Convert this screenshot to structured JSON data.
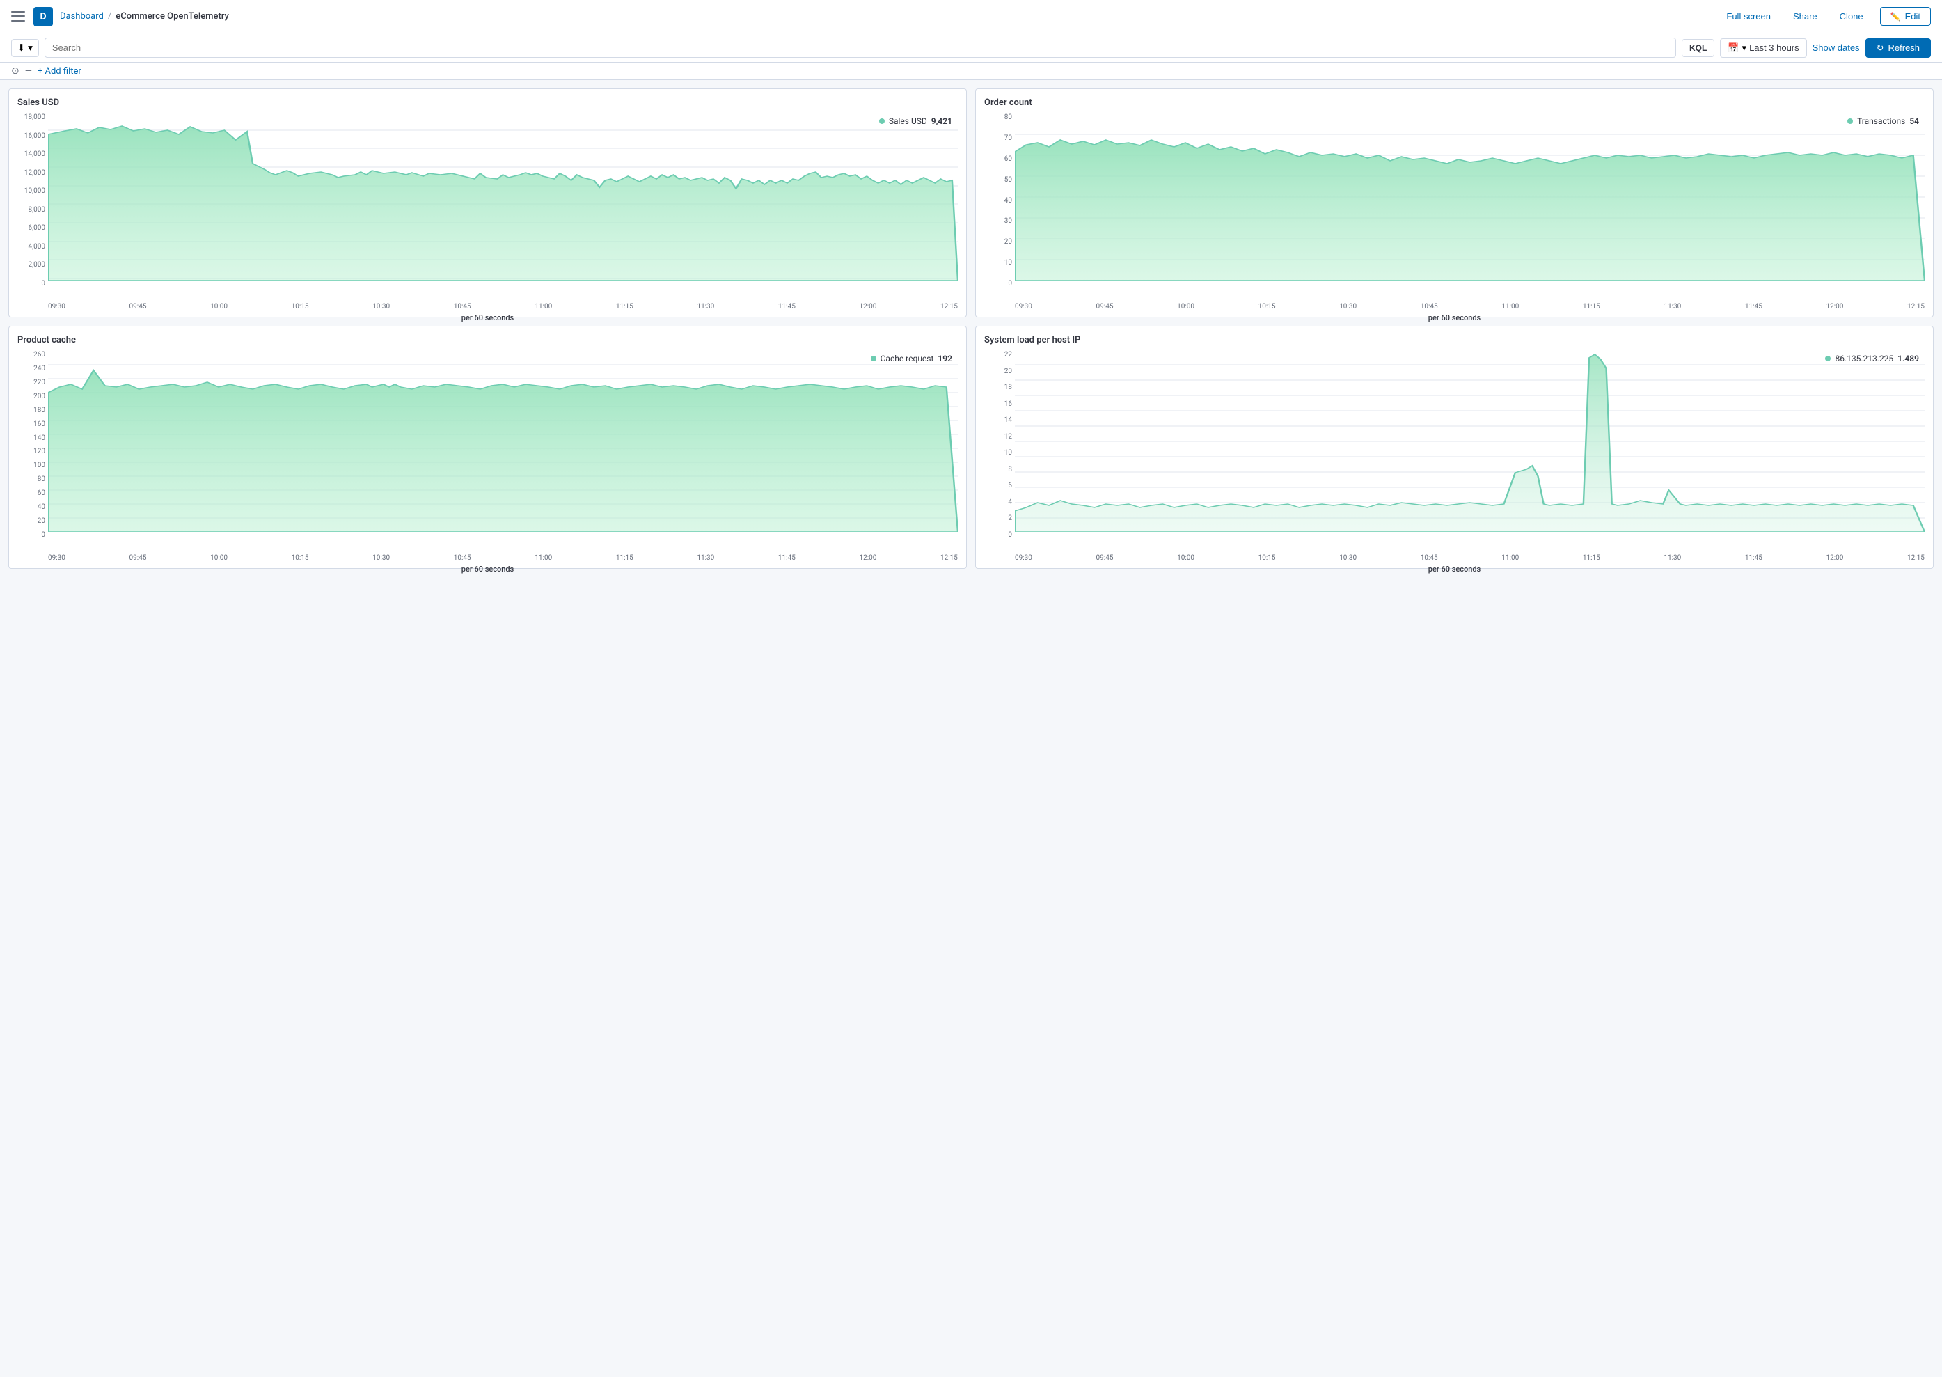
{
  "topNav": {
    "appIconLabel": "D",
    "breadcrumbParent": "Dashboard",
    "breadcrumbCurrent": "eCommerce OpenTelemetry",
    "fullscreen": "Full screen",
    "share": "Share",
    "clone": "Clone",
    "edit": "Edit"
  },
  "filterBar": {
    "searchPlaceholder": "Search",
    "kqlLabel": "KQL",
    "timeLabel": "Last 3 hours",
    "showDates": "Show dates",
    "refresh": "Refresh"
  },
  "addFilter": {
    "label": "+ Add filter"
  },
  "panels": {
    "salesUSD": {
      "title": "Sales USD",
      "legendLabel": "Sales USD",
      "legendValue": "9,421",
      "yAxis": [
        "18,000",
        "16,000",
        "14,000",
        "12,000",
        "10,000",
        "8,000",
        "6,000",
        "4,000",
        "2,000",
        "0"
      ],
      "xAxis": [
        "09:30",
        "09:45",
        "10:00",
        "10:15",
        "10:30",
        "10:45",
        "11:00",
        "11:15",
        "11:30",
        "11:45",
        "12:00",
        "12:15"
      ],
      "xLabel": "per 60 seconds"
    },
    "orderCount": {
      "title": "Order count",
      "legendLabel": "Transactions",
      "legendValue": "54",
      "yAxis": [
        "80",
        "70",
        "60",
        "50",
        "40",
        "30",
        "20",
        "10",
        "0"
      ],
      "xAxis": [
        "09:30",
        "09:45",
        "10:00",
        "10:15",
        "10:30",
        "10:45",
        "11:00",
        "11:15",
        "11:30",
        "11:45",
        "12:00",
        "12:15"
      ],
      "xLabel": "per 60 seconds"
    },
    "productCache": {
      "title": "Product cache",
      "legendLabel": "Cache request",
      "legendValue": "192",
      "yAxis": [
        "260",
        "240",
        "220",
        "200",
        "180",
        "160",
        "140",
        "120",
        "100",
        "80",
        "60",
        "40",
        "20",
        "0"
      ],
      "xAxis": [
        "09:30",
        "09:45",
        "10:00",
        "10:15",
        "10:30",
        "10:45",
        "11:00",
        "11:15",
        "11:30",
        "11:45",
        "12:00",
        "12:15"
      ],
      "xLabel": "per 60 seconds"
    },
    "systemLoad": {
      "title": "System load per host IP",
      "legendLabel": "86.135.213.225",
      "legendValue": "1.489",
      "yAxis": [
        "22",
        "20",
        "18",
        "16",
        "14",
        "12",
        "10",
        "8",
        "6",
        "4",
        "2",
        "0"
      ],
      "xAxis": [
        "09:30",
        "09:45",
        "10:00",
        "10:15",
        "10:30",
        "10:45",
        "11:00",
        "11:15",
        "11:30",
        "11:45",
        "12:00",
        "12:15"
      ],
      "xLabel": "per 60 seconds"
    }
  }
}
